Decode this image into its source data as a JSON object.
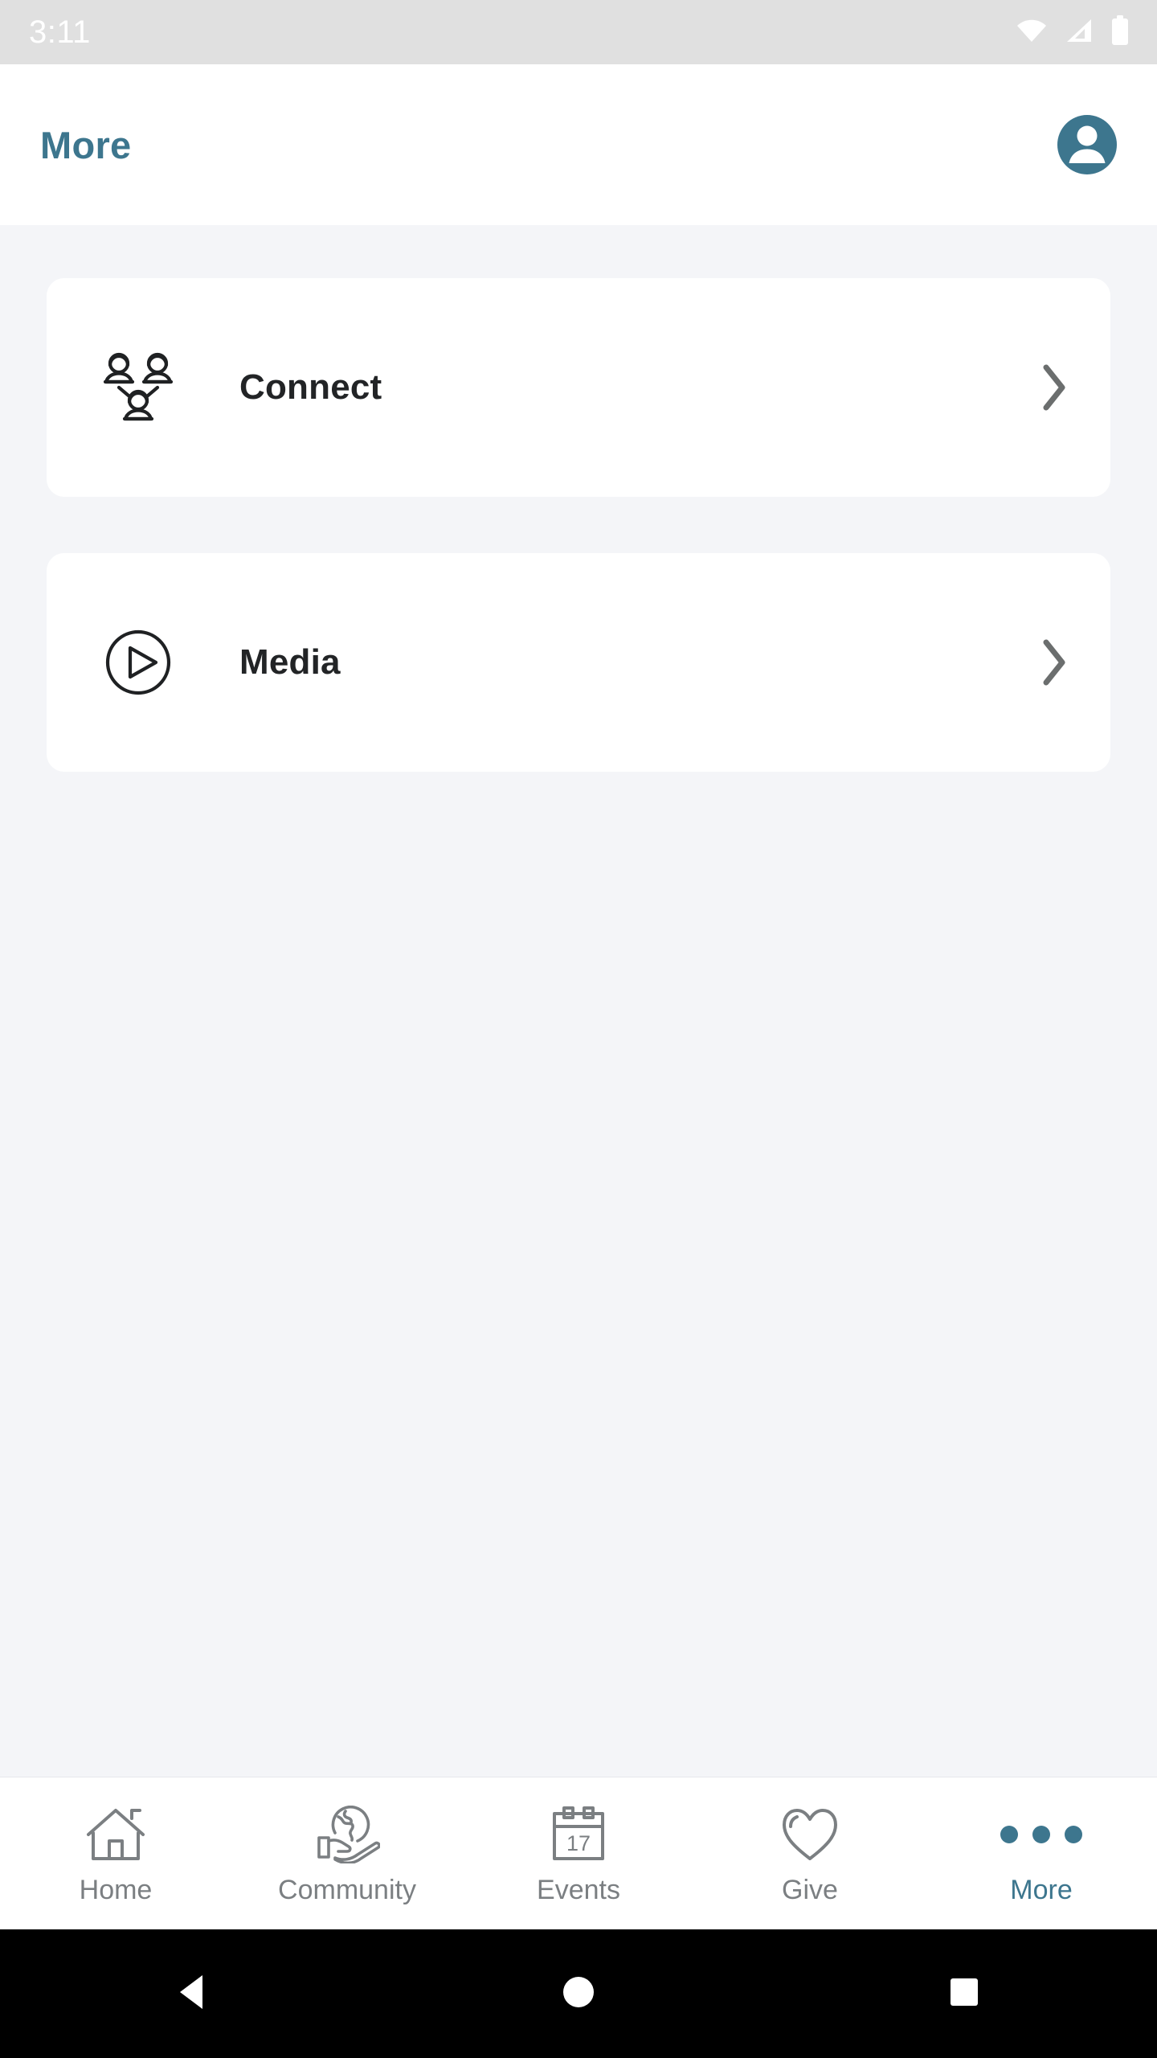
{
  "status_bar": {
    "time": "3:11",
    "background_color": "#e0e0e0",
    "foreground_color": "#ffffff",
    "icons": [
      "wifi-icon",
      "cell-signal-icon",
      "battery-icon"
    ]
  },
  "header": {
    "title": "More",
    "title_color": "#3d768e",
    "avatar_icon": "user-avatar-icon",
    "avatar_background": "#3d768e"
  },
  "theme": {
    "accent": "#3d768e",
    "page_background": "#f4f5f8",
    "card_background": "#ffffff",
    "text_primary": "#222426",
    "text_muted": "#7b7f82",
    "chevron": "#6b6e6e"
  },
  "menu": {
    "items": [
      {
        "label": "Connect",
        "icon": "people-network-icon",
        "chevron": "chevron-right-icon"
      },
      {
        "label": "Media",
        "icon": "play-circle-icon",
        "chevron": "chevron-right-icon"
      }
    ]
  },
  "bottom_nav": {
    "items": [
      {
        "label": "Home",
        "icon": "home-icon",
        "active": false
      },
      {
        "label": "Community",
        "icon": "globe-in-hand-icon",
        "active": false
      },
      {
        "label": "Events",
        "icon": "calendar-icon",
        "active": false,
        "day_number": "17"
      },
      {
        "label": "Give",
        "icon": "heart-icon",
        "active": false
      },
      {
        "label": "More",
        "icon": "three-dots-icon",
        "active": true
      }
    ]
  },
  "system_nav": {
    "buttons": [
      {
        "name": "back",
        "icon": "triangle-back-icon"
      },
      {
        "name": "home",
        "icon": "circle-home-icon"
      },
      {
        "name": "recents",
        "icon": "square-recents-icon"
      }
    ]
  }
}
